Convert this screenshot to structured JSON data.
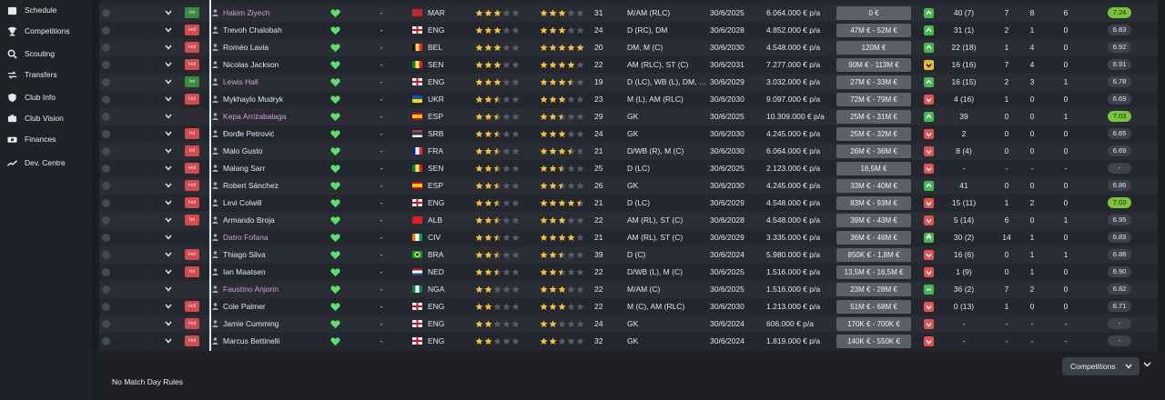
{
  "sidebar": {
    "items": [
      {
        "label": "Schedule",
        "icon": "calendar-icon"
      },
      {
        "label": "Competitions",
        "icon": "trophy-icon"
      },
      {
        "label": "Scouting",
        "icon": "binoculars-icon"
      },
      {
        "label": "Transfers",
        "icon": "transfer-icon"
      },
      {
        "label": "Club Info",
        "icon": "shield-icon"
      },
      {
        "label": "Club Vision",
        "icon": "vision-icon"
      },
      {
        "label": "Finances",
        "icon": "money-icon"
      },
      {
        "label": "Dev. Centre",
        "icon": "graph-icon"
      }
    ]
  },
  "colors": {
    "selection_dash": "#8e333a",
    "tag_red": "#d14b4f",
    "tag_green": "#3a8a3f",
    "heart": "#57e26b",
    "star_filled": "#f3c33a",
    "star_empty": "#5a5d66",
    "trend_up": "#44b94f",
    "trend_down": "#e0534f",
    "trend_warn": "#e9b73a",
    "rating_high": "#78c43a",
    "favourite_name": "#d39be3"
  },
  "table": {
    "rows": [
      {
        "sel": "-",
        "tag": "Int",
        "tag_color": "green",
        "name": "Hakim Ziyech",
        "pink": true,
        "hyphen": "-",
        "flag": "MAR",
        "nat": "MAR",
        "stars1": 3,
        "stars2": 3,
        "age": "31",
        "position": "M/AM (RLC)",
        "contract": "30/6/2025",
        "wage": "6.064.000 € p/a",
        "value": "0 €",
        "trend": "up",
        "apps": "40 (7)",
        "goals": "7",
        "assists": "8",
        "pom": "6",
        "rating": "7.24",
        "rating_high": true
      },
      {
        "sel": "-",
        "tag": "Hol",
        "tag_color": "red",
        "name": "Trevoh Chalobah",
        "pink": false,
        "hyphen": "-",
        "flag": "ENG",
        "nat": "ENG",
        "stars1": 3,
        "stars2": 3,
        "age": "24",
        "position": "D (RC), DM",
        "contract": "30/6/2028",
        "wage": "4.852.000 € p/a",
        "value": "47M € - 52M €",
        "trend": "up",
        "apps": "31 (1)",
        "goals": "2",
        "assists": "1",
        "pom": "0",
        "rating": "6.83",
        "rating_high": false
      },
      {
        "sel": "-",
        "tag": "Hol",
        "tag_color": "red",
        "name": "Roméo Lavia",
        "pink": false,
        "hyphen": "-",
        "flag": "BEL",
        "nat": "BEL",
        "stars1": 3,
        "stars2": 5,
        "age": "20",
        "position": "DM, M (C)",
        "contract": "30/6/2030",
        "wage": "4.548.000 € p/a",
        "value": "120M €",
        "trend": "up",
        "apps": "22 (18)",
        "goals": "1",
        "assists": "4",
        "pom": "0",
        "rating": "6.92",
        "rating_high": false
      },
      {
        "sel": "-",
        "tag": "Hol",
        "tag_color": "red",
        "name": "Nicolas Jackson",
        "pink": false,
        "hyphen": "-",
        "flag": "SEN",
        "nat": "SEN",
        "stars1": 3,
        "stars2": 4,
        "age": "22",
        "position": "AM (RLC), ST (C)",
        "contract": "30/6/2031",
        "wage": "7.277.000 € p/a",
        "value": "90M € - 113M €",
        "trend": "warn",
        "apps": "16 (16)",
        "goals": "7",
        "assists": "4",
        "pom": "0",
        "rating": "6.91",
        "rating_high": false
      },
      {
        "sel": "-",
        "tag": "Int",
        "tag_color": "green",
        "name": "Lewis Hall",
        "pink": true,
        "hyphen": "-",
        "flag": "ENG",
        "nat": "ENG",
        "stars1": 3,
        "stars2": 3.5,
        "age": "19",
        "position": "D (LC), WB (L), DM, M...",
        "contract": "30/6/2029",
        "wage": "3.032.000 € p/a",
        "value": "27M € - 33M €",
        "trend": "up",
        "apps": "16 (15)",
        "goals": "2",
        "assists": "3",
        "pom": "1",
        "rating": "6.78",
        "rating_high": false
      },
      {
        "sel": "-",
        "tag": "Hol",
        "tag_color": "red",
        "name": "Mykhaylo Mudryk",
        "pink": false,
        "hyphen": "-",
        "flag": "UKR",
        "nat": "UKR",
        "stars1": 2.5,
        "stars2": 3,
        "age": "23",
        "position": "M (L), AM (RLC)",
        "contract": "30/6/2030",
        "wage": "9.097.000 € p/a",
        "value": "72M € - 79M €",
        "trend": "down",
        "apps": "4 (16)",
        "goals": "1",
        "assists": "0",
        "pom": "0",
        "rating": "6.69",
        "rating_high": false
      },
      {
        "sel": "-",
        "tag": "",
        "tag_color": "",
        "name": "Kepa Arrizabalaga",
        "pink": true,
        "hyphen": "-",
        "flag": "ESP",
        "nat": "ESP",
        "stars1": 2.5,
        "stars2": 2.5,
        "age": "29",
        "position": "GK",
        "contract": "30/6/2025",
        "wage": "10.309.000 € p/a",
        "value": "25M € - 31M €",
        "trend": "up",
        "apps": "39",
        "goals": "0",
        "assists": "0",
        "pom": "1",
        "rating": "7.03",
        "rating_high": true
      },
      {
        "sel": "-",
        "tag": "Int",
        "tag_color": "red",
        "name": "Đorđe Petrović",
        "pink": false,
        "hyphen": "-",
        "flag": "SRB",
        "nat": "SRB",
        "stars1": 2.5,
        "stars2": 3,
        "age": "24",
        "position": "GK",
        "contract": "30/6/2030",
        "wage": "4.245.000 € p/a",
        "value": "25M € - 32M €",
        "trend": "down",
        "apps": "2",
        "goals": "0",
        "assists": "0",
        "pom": "0",
        "rating": "6.65",
        "rating_high": false
      },
      {
        "sel": "-",
        "tag": "Int",
        "tag_color": "red",
        "name": "Malo Gusto",
        "pink": false,
        "hyphen": "-",
        "flag": "FRA",
        "nat": "FRA",
        "stars1": 2.5,
        "stars2": 3.5,
        "age": "21",
        "position": "D/WB (R), M (C)",
        "contract": "30/6/2030",
        "wage": "6.064.000 € p/a",
        "value": "26M € - 36M €",
        "trend": "down",
        "apps": "8 (4)",
        "goals": "0",
        "assists": "0",
        "pom": "0",
        "rating": "6.69",
        "rating_high": false
      },
      {
        "sel": "-",
        "tag": "Hol",
        "tag_color": "red",
        "name": "Malang Sarr",
        "pink": false,
        "hyphen": "-",
        "flag": "SEN",
        "nat": "SEN",
        "stars1": 2.5,
        "stars2": 2.5,
        "age": "25",
        "position": "D (LC)",
        "contract": "30/6/2025",
        "wage": "2.123.000 € p/a",
        "value": "16,5M €",
        "trend": "down",
        "apps": "-",
        "goals": "-",
        "assists": "-",
        "pom": "-",
        "rating": "-",
        "rating_high": false
      },
      {
        "sel": "-",
        "tag": "Hol",
        "tag_color": "red",
        "name": "Robert Sánchez",
        "pink": false,
        "hyphen": "-",
        "flag": "ESP",
        "nat": "ESP",
        "stars1": 2.5,
        "stars2": 2.5,
        "age": "26",
        "position": "GK",
        "contract": "30/6/2030",
        "wage": "4.245.000 € p/a",
        "value": "33M € - 40M €",
        "trend": "up",
        "apps": "41",
        "goals": "0",
        "assists": "0",
        "pom": "0",
        "rating": "6.86",
        "rating_high": false
      },
      {
        "sel": "-",
        "tag": "Hol",
        "tag_color": "red",
        "name": "Levi Colwill",
        "pink": false,
        "hyphen": "-",
        "flag": "ENG",
        "nat": "ENG",
        "stars1": 2.5,
        "stars2": 4.5,
        "age": "21",
        "position": "D (LC)",
        "contract": "30/6/2029",
        "wage": "4.548.000 € p/a",
        "value": "83M € - 93M €",
        "trend": "down",
        "apps": "15 (11)",
        "goals": "1",
        "assists": "2",
        "pom": "0",
        "rating": "7.03",
        "rating_high": true
      },
      {
        "sel": "-",
        "tag": "Int",
        "tag_color": "red",
        "name": "Armando Broja",
        "pink": false,
        "hyphen": "-",
        "flag": "ALB",
        "nat": "ALB",
        "stars1": 2.5,
        "stars2": 3,
        "age": "22",
        "position": "AM (RL), ST (C)",
        "contract": "30/6/2028",
        "wage": "4.548.000 € p/a",
        "value": "39M € - 43M €",
        "trend": "down",
        "apps": "5 (14)",
        "goals": "6",
        "assists": "0",
        "pom": "1",
        "rating": "6.95",
        "rating_high": false
      },
      {
        "sel": "-",
        "tag": "",
        "tag_color": "",
        "name": "Datro Fofana",
        "pink": true,
        "hyphen": "-",
        "flag": "CIV",
        "nat": "CIV",
        "stars1": 2.5,
        "stars2": 4,
        "age": "21",
        "position": "AM (RL), ST (C)",
        "contract": "30/6/2029",
        "wage": "3.335.000 € p/a",
        "value": "36M € - 46M €",
        "trend": "upbig",
        "apps": "30 (2)",
        "goals": "14",
        "assists": "1",
        "pom": "0",
        "rating": "6.83",
        "rating_high": false
      },
      {
        "sel": "-",
        "tag": "Hol",
        "tag_color": "red",
        "name": "Thiago Silva",
        "pink": false,
        "hyphen": "-",
        "flag": "BRA",
        "nat": "BRA",
        "stars1": 2.5,
        "stars2": 2.5,
        "age": "39",
        "position": "D (C)",
        "contract": "30/6/2024",
        "wage": "5.980.000 € p/a",
        "value": "850K € - 1,8M €",
        "trend": "down",
        "apps": "16 (6)",
        "goals": "0",
        "assists": "1",
        "pom": "1",
        "rating": "6.88",
        "rating_high": false
      },
      {
        "sel": "-",
        "tag": "Int",
        "tag_color": "red",
        "name": "Ian Maatsen",
        "pink": false,
        "hyphen": "-",
        "flag": "NED",
        "nat": "NED",
        "stars1": 2.5,
        "stars2": 2.5,
        "age": "22",
        "position": "D/WB (L), M (C)",
        "contract": "30/6/2025",
        "wage": "1.516.000 € p/a",
        "value": "13,5M € - 16,5M €",
        "trend": "down",
        "apps": "1 (9)",
        "goals": "0",
        "assists": "1",
        "pom": "0",
        "rating": "6.90",
        "rating_high": false
      },
      {
        "sel": "-",
        "tag": "",
        "tag_color": "",
        "name": "Faustino Anjorin",
        "pink": true,
        "hyphen": "-",
        "flag": "NGA",
        "nat": "NGA",
        "stars1": 2,
        "stars2": 3,
        "age": "22",
        "position": "M/AM (C)",
        "contract": "30/6/2025",
        "wage": "1.516.000 € p/a",
        "value": "23M € - 28M €",
        "trend": "flat",
        "apps": "36 (2)",
        "goals": "7",
        "assists": "2",
        "pom": "0",
        "rating": "6.82",
        "rating_high": false
      },
      {
        "sel": "-",
        "tag": "Hol",
        "tag_color": "red",
        "name": "Cole Palmer",
        "pink": false,
        "hyphen": "-",
        "flag": "ENG",
        "nat": "ENG",
        "stars1": 2,
        "stars2": 3,
        "age": "22",
        "position": "M (C), AM (RLC)",
        "contract": "30/6/2030",
        "wage": "1.213.000 € p/a",
        "value": "51M € - 68M €",
        "trend": "down",
        "apps": "0 (13)",
        "goals": "1",
        "assists": "0",
        "pom": "0",
        "rating": "6.71",
        "rating_high": false
      },
      {
        "sel": "-",
        "tag": "Hol",
        "tag_color": "red",
        "name": "Jamie Cumming",
        "pink": false,
        "hyphen": "-",
        "flag": "ENG",
        "nat": "ENG",
        "stars1": 2,
        "stars2": 2,
        "age": "24",
        "position": "GK",
        "contract": "30/6/2024",
        "wage": "606.000 € p/a",
        "value": "170K € - 700K €",
        "trend": "down",
        "apps": "-",
        "goals": "-",
        "assists": "-",
        "pom": "-",
        "rating": "-",
        "rating_high": false
      },
      {
        "sel": "-",
        "tag": "Hol",
        "tag_color": "red",
        "name": "Marcus Bettinelli",
        "pink": false,
        "hyphen": "-",
        "flag": "ENG",
        "nat": "ENG",
        "stars1": 2,
        "stars2": 2,
        "age": "32",
        "position": "GK",
        "contract": "30/6/2024",
        "wage": "1.819.000 € p/a",
        "value": "140K € - 550K €",
        "trend": "down",
        "apps": "-",
        "goals": "-",
        "assists": "-",
        "pom": "-",
        "rating": "-",
        "rating_high": false
      }
    ]
  },
  "footer": {
    "rules_text": "No Match Day Rules",
    "dropdown_label": "Competitions"
  }
}
